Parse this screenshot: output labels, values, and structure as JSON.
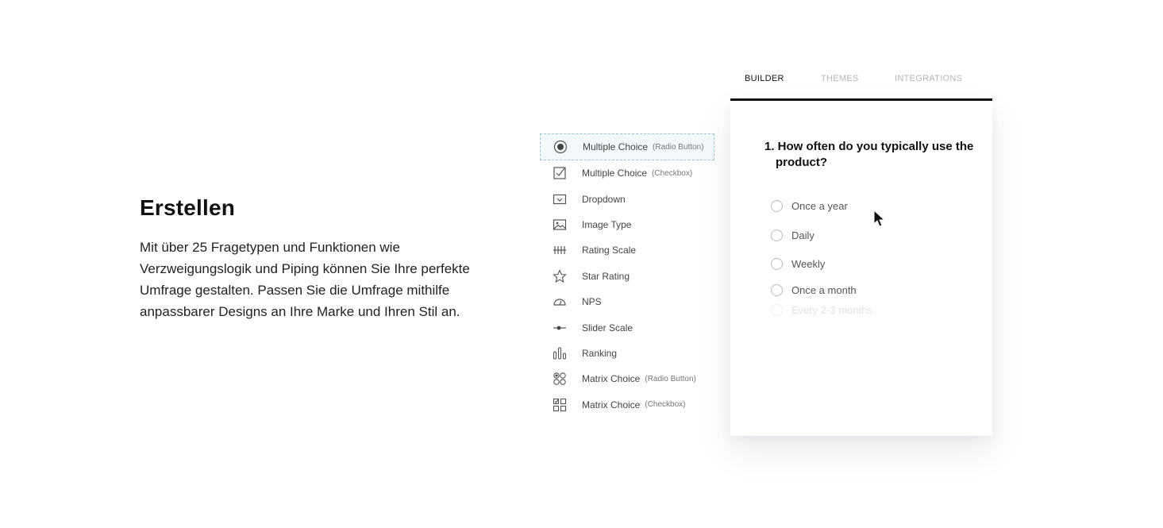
{
  "intro": {
    "title": "Erstellen",
    "body": "Mit über 25 Fragetypen und Funktionen wie Verzweigungslogik und Piping können Sie Ihre perfekte Umfrage gestalten. Passen Sie die Umfrage mithilfe anpassbarer Designs an Ihre Marke und Ihren Stil an."
  },
  "question_types": [
    {
      "label": "Multiple Choice",
      "sub": "(Radio Button)",
      "icon": "radio-button-icon",
      "selected": true
    },
    {
      "label": "Multiple Choice",
      "sub": "(Checkbox)",
      "icon": "checkbox-icon"
    },
    {
      "label": "Dropdown",
      "sub": "",
      "icon": "dropdown-icon"
    },
    {
      "label": "Image Type",
      "sub": "",
      "icon": "image-icon"
    },
    {
      "label": "Rating Scale",
      "sub": "",
      "icon": "rating-scale-icon"
    },
    {
      "label": "Star Rating",
      "sub": "",
      "icon": "star-icon"
    },
    {
      "label": "NPS",
      "sub": "",
      "icon": "gauge-icon"
    },
    {
      "label": "Slider Scale",
      "sub": "",
      "icon": "slider-icon"
    },
    {
      "label": "Ranking",
      "sub": "",
      "icon": "ranking-icon"
    },
    {
      "label": "Matrix Choice",
      "sub": "(Radio Button)",
      "icon": "matrix-radio-icon"
    },
    {
      "label": "Matrix Choice",
      "sub": "(Checkbox)",
      "icon": "matrix-checkbox-icon"
    }
  ],
  "tabs": {
    "builder": "BUILDER",
    "themes": "THEMES",
    "integrations": "INTEGRATIONS",
    "active": "builder"
  },
  "preview": {
    "question": "1. How often do you typically use the product?",
    "options": [
      "Once a year",
      "Daily",
      "Weekly",
      "Once a month",
      "Every 2-3 months"
    ]
  }
}
